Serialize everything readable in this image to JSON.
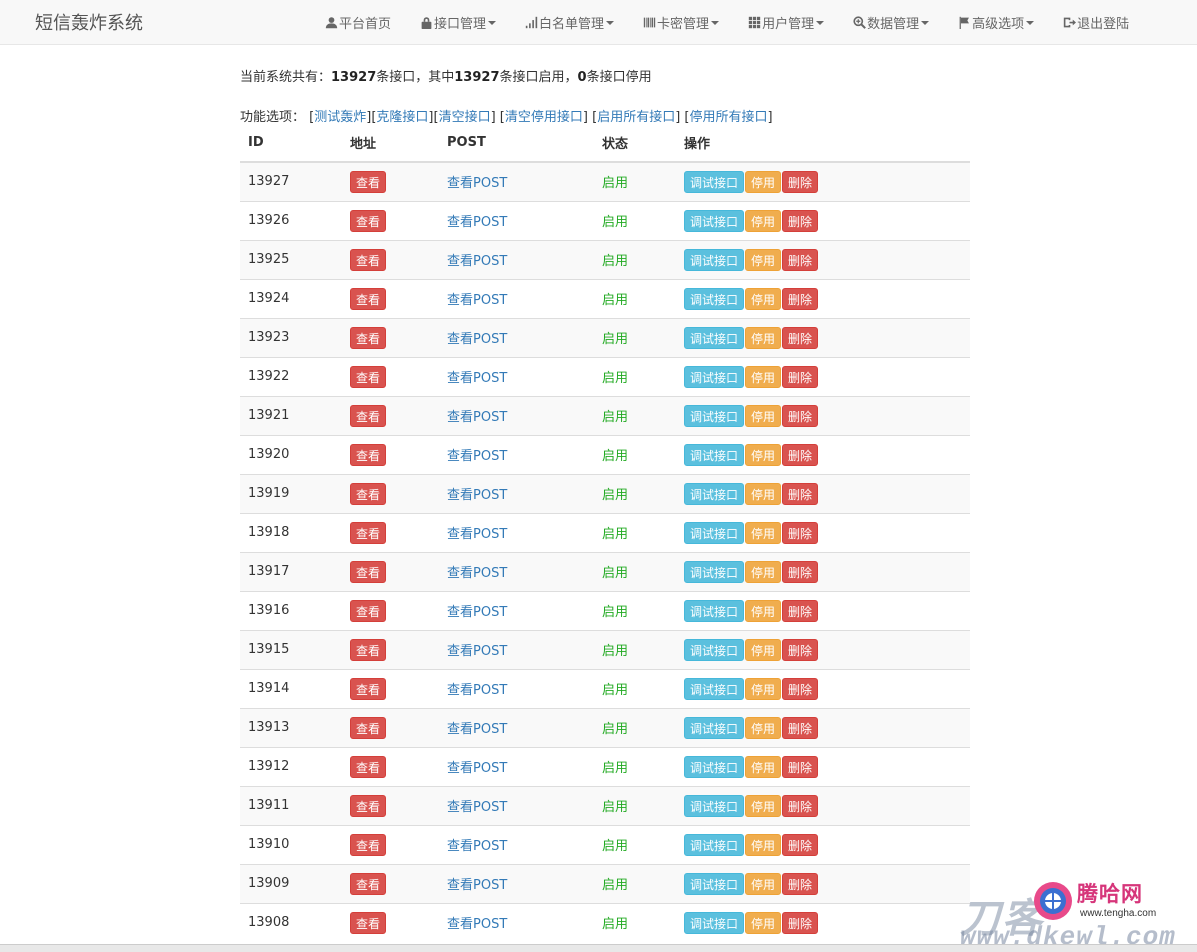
{
  "brand": "短信轰炸系统",
  "nav": [
    {
      "icon": "user-icon",
      "label": "平台首页",
      "dropdown": false
    },
    {
      "icon": "lock-icon",
      "label": "接口管理",
      "dropdown": true
    },
    {
      "icon": "signal-icon",
      "label": "白名单管理",
      "dropdown": true
    },
    {
      "icon": "barcode-icon",
      "label": "卡密管理",
      "dropdown": true
    },
    {
      "icon": "grid-icon",
      "label": "用户管理",
      "dropdown": true
    },
    {
      "icon": "zoom-in-icon",
      "label": "数据管理",
      "dropdown": true
    },
    {
      "icon": "flag-icon",
      "label": "高级选项",
      "dropdown": true
    },
    {
      "icon": "log-out-icon",
      "label": "退出登陆",
      "dropdown": false
    }
  ],
  "summary": {
    "prefix": "当前系统共有：",
    "total": "13927",
    "mid1": "条接口，其中",
    "enabled": "13927",
    "mid2": "条接口启用，",
    "disabled": "0",
    "suffix": "条接口停用"
  },
  "functions": {
    "label": "功能选项：",
    "links": [
      "测试轰炸",
      "克隆接口",
      "清空接口",
      "清空停用接口",
      "启用所有接口",
      "停用所有接口"
    ]
  },
  "table": {
    "headers": [
      "ID",
      "地址",
      "POST",
      "状态",
      "操作"
    ],
    "view_label": "查看",
    "post_label": "查看POST",
    "debug_label": "调试接口",
    "disable_label": "停用",
    "delete_label": "删除",
    "rows": [
      {
        "id": "13927",
        "status": "启用"
      },
      {
        "id": "13926",
        "status": "启用"
      },
      {
        "id": "13925",
        "status": "启用"
      },
      {
        "id": "13924",
        "status": "启用"
      },
      {
        "id": "13923",
        "status": "启用"
      },
      {
        "id": "13922",
        "status": "启用"
      },
      {
        "id": "13921",
        "status": "启用"
      },
      {
        "id": "13920",
        "status": "启用"
      },
      {
        "id": "13919",
        "status": "启用"
      },
      {
        "id": "13918",
        "status": "启用"
      },
      {
        "id": "13917",
        "status": "启用"
      },
      {
        "id": "13916",
        "status": "启用"
      },
      {
        "id": "13915",
        "status": "启用"
      },
      {
        "id": "13914",
        "status": "启用"
      },
      {
        "id": "13913",
        "status": "启用"
      },
      {
        "id": "13912",
        "status": "启用"
      },
      {
        "id": "13911",
        "status": "启用"
      },
      {
        "id": "13910",
        "status": "启用"
      },
      {
        "id": "13909",
        "status": "启用"
      },
      {
        "id": "13908",
        "status": "启用"
      }
    ]
  },
  "watermark": {
    "brand": "腾哈网",
    "brand_url": "www.tengha.com",
    "site": "刀客",
    "site_url": "www.dkewl.com"
  },
  "colors": {
    "danger": "#d9534f",
    "info": "#5bc0de",
    "warning": "#f0ad4e",
    "link": "#337ab7",
    "enabled": "#22aa22"
  }
}
